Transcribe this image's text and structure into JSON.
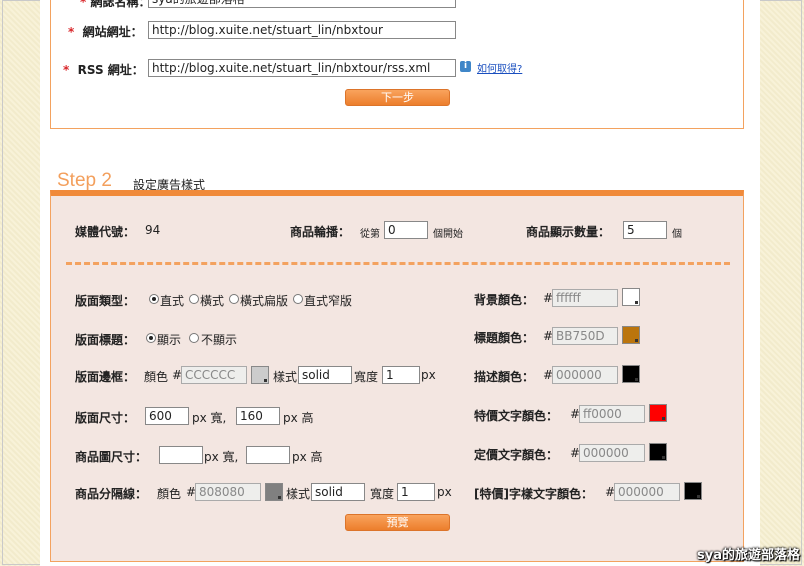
{
  "form": {
    "blog_name_label": "網誌名稱：",
    "blog_name_value": "sya的旅遊部落格",
    "site_url_label": "網站網址：",
    "site_url_value": "http://blog.xuite.net/stuart_lin/nbxtour",
    "rss_label": "RSS 網址：",
    "rss_value": "http://blog.xuite.net/stuart_lin/nbxtour/rss.xml",
    "required_mark": "*",
    "help_link": "如何取得?",
    "next_button": "下一步"
  },
  "step2": {
    "step_title": "Step 2",
    "subtitle": "設定廣告樣式",
    "media_code_label": "媒體代號：",
    "media_code_value": "94",
    "rotation_label": "商品輪播：",
    "rotation_prefix": "從第",
    "rotation_value": "0",
    "rotation_suffix": "個開始",
    "count_label": "商品顯示數量：",
    "count_value": "5",
    "count_unit": "個"
  },
  "layout": {
    "type_label": "版面類型：",
    "type_options": [
      "直式",
      "橫式",
      "橫式扁版",
      "直式窄版"
    ],
    "title_label": "版面標題：",
    "title_options": [
      "顯示",
      "不顯示"
    ],
    "border_label": "版面邊框：",
    "color_word": "顏色",
    "hash": "#",
    "border_color": "CCCCCC",
    "style_word": "樣式",
    "border_style": "solid",
    "width_word": "寬度",
    "border_width": "1",
    "px": "px",
    "size_label": "版面尺寸：",
    "size_w": "600",
    "size_h": "160",
    "px_wide": "px 寬,",
    "px_high": "px 高",
    "img_size_label": "商品圖尺寸：",
    "img_w": "",
    "img_h": "",
    "divider_label": "商品分隔線：",
    "divider_color": "808080",
    "divider_style": "solid",
    "divider_width": "1",
    "preview_button": "預覽"
  },
  "colors": {
    "bg_label": "背景顏色：",
    "bg_value": "ffffff",
    "title_color_label": "標題顏色：",
    "title_color_value": "BB750D",
    "desc_label": "描述顏色：",
    "desc_value": "000000",
    "special_label": "特價文字顏色：",
    "special_value": "ff0000",
    "fixed_label": "定價文字顏色：",
    "fixed_value": "000000",
    "tag_label": "[特價]字樣文字顏色：",
    "tag_value": "000000",
    "swatches": {
      "border": "#CCCCCC",
      "divider": "#808080",
      "bg": "#ffffff",
      "title": "#BB750D",
      "desc": "#000000",
      "special": "#ff0000",
      "fixed": "#000000",
      "tag": "#000000"
    }
  },
  "watermark": "sya的旅遊部落格"
}
